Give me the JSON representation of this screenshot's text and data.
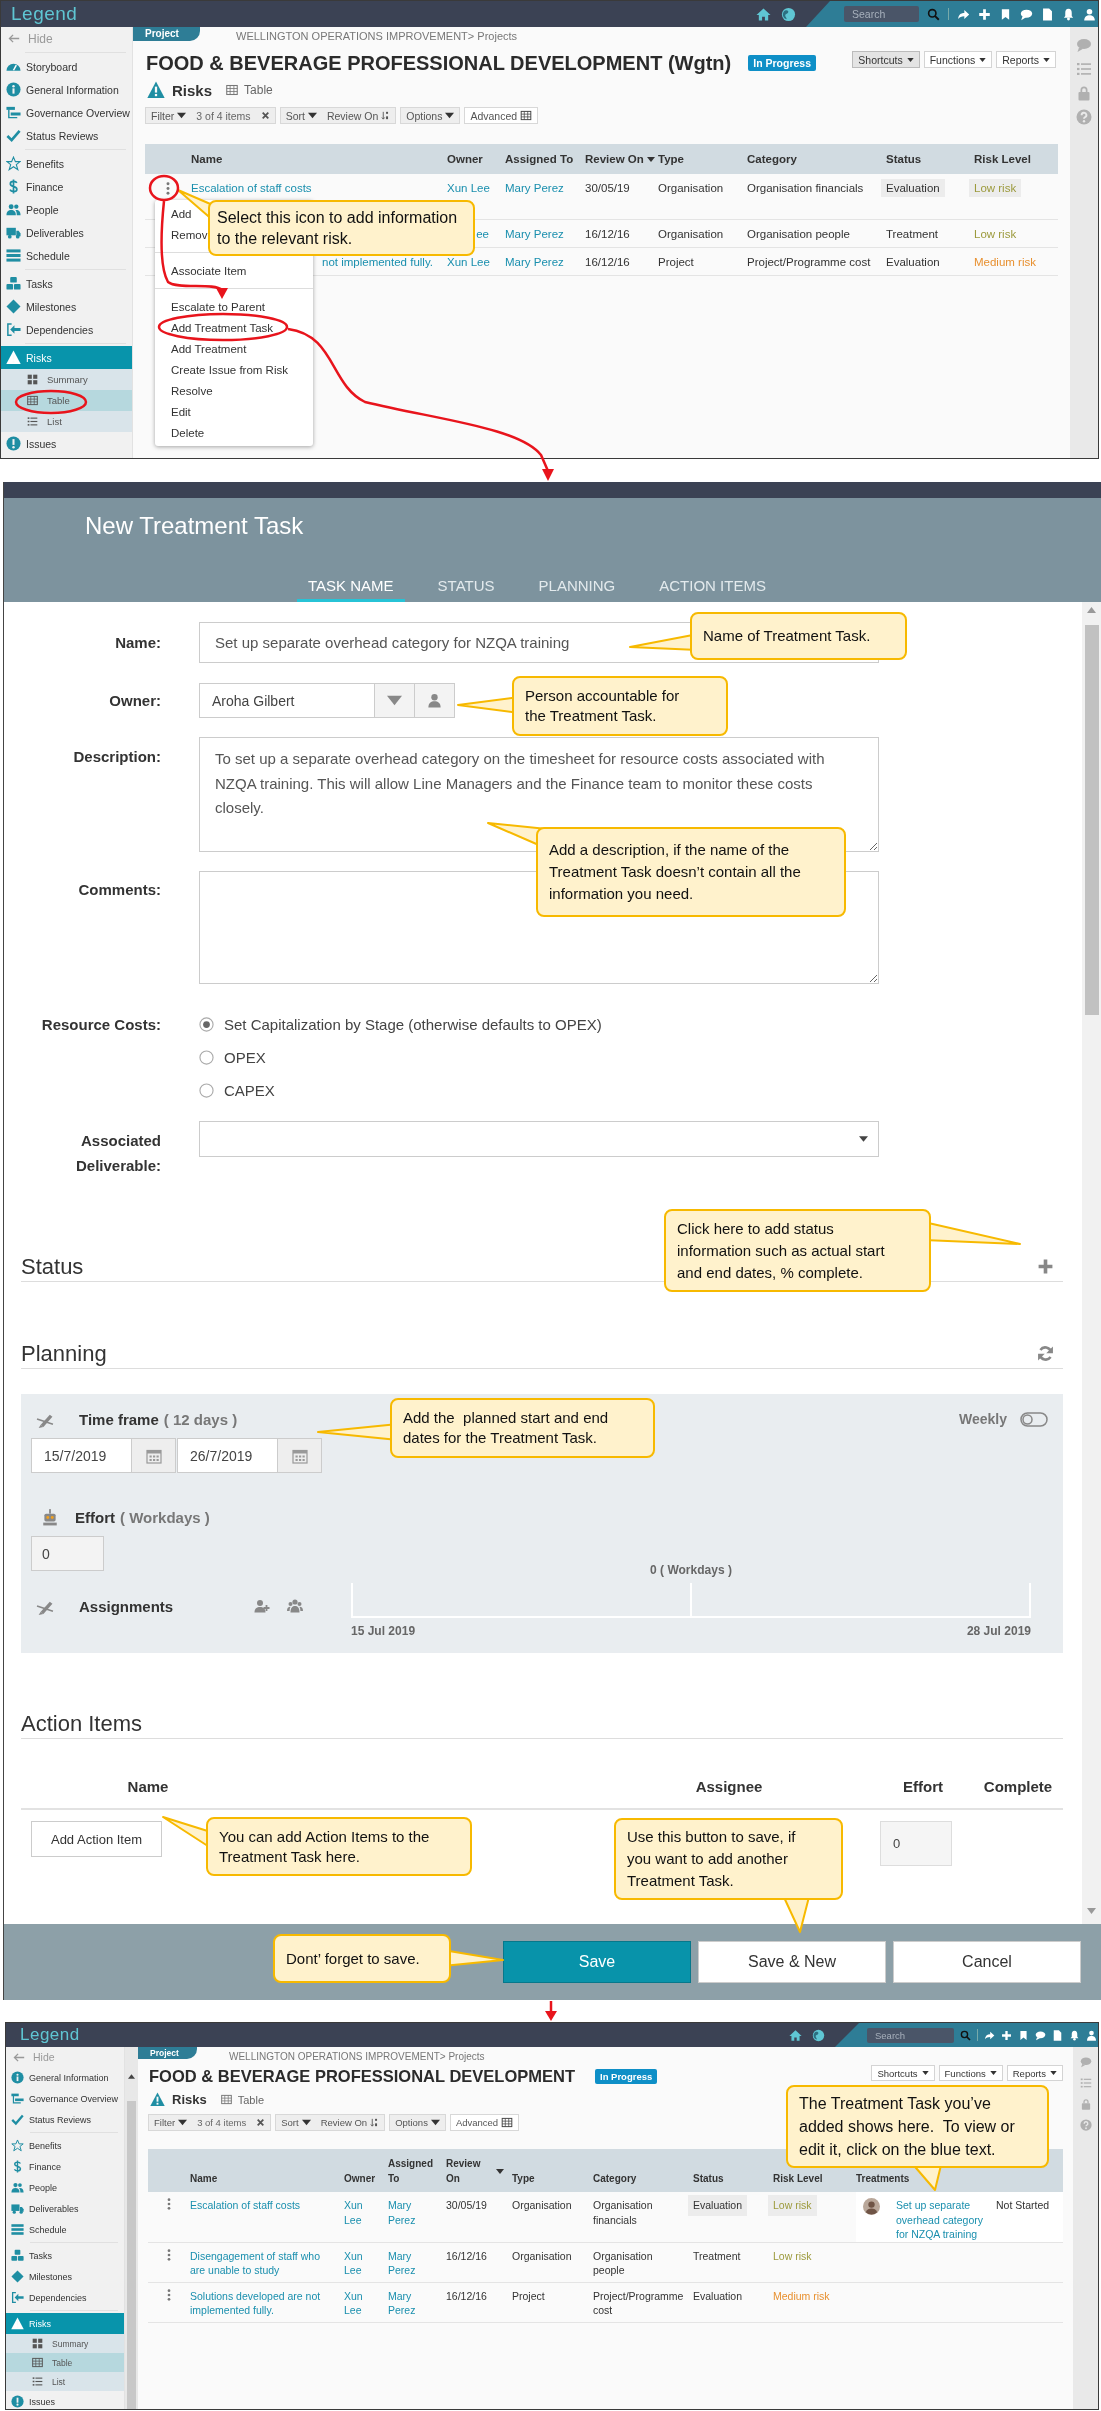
{
  "risks_table_before": {
    "top_bar": {
      "logo": "Legend",
      "search": {
        "placeholder": "Search"
      }
    },
    "sidebar": {
      "hide": "Hide",
      "groups": [
        [
          {
            "label": "Storyboard",
            "selected": false
          },
          {
            "label": "General Information",
            "selected": false
          },
          {
            "label": "Governance Overview",
            "selected": false
          },
          {
            "label": "Status Reviews",
            "selected": false
          }
        ],
        [
          {
            "label": "Benefits",
            "selected": false
          },
          {
            "label": "Finance",
            "selected": false
          },
          {
            "label": "People",
            "selected": false
          },
          {
            "label": "Deliverables",
            "selected": false
          },
          {
            "label": "Schedule",
            "selected": false
          }
        ],
        [
          {
            "label": "Tasks",
            "selected": false
          },
          {
            "label": "Milestones",
            "selected": false
          },
          {
            "label": "Dependencies",
            "selected": false
          }
        ],
        [
          {
            "label": "Risks",
            "selected": true,
            "children": [
              {
                "label": "Summary",
                "selected": false
              },
              {
                "label": "Table",
                "selected": true
              },
              {
                "label": "List",
                "selected": false
              }
            ]
          },
          {
            "label": "Issues",
            "selected": false
          }
        ]
      ]
    },
    "project_tag": "Project",
    "breadcrumb": "WELLINGTON OPERATIONS IMPROVEMENT> Projects",
    "title": "FOOD & BEVERAGE PROFESSIONAL DEVELOPMENT (Wgtn)",
    "status_badge": "In Progress",
    "header_buttons": [
      {
        "label": "Shortcuts",
        "selected": true
      },
      {
        "label": "Functions",
        "selected": false
      },
      {
        "label": "Reports",
        "selected": false
      }
    ],
    "section_title": "Risks",
    "view_label": "Table",
    "toolbar": {
      "filter": "Filter",
      "filter_count": "3 of 4 items",
      "sort": "Sort",
      "sort_field": "Review On",
      "options": "Options",
      "advanced": "Advanced"
    },
    "table": {
      "columns": [
        {
          "label": "Name",
          "sorted": false
        },
        {
          "label": "Owner",
          "sorted": false
        },
        {
          "label": "Assigned To",
          "sorted": false
        },
        {
          "label": "Review On",
          "sorted": true
        },
        {
          "label": "Type",
          "sorted": false
        },
        {
          "label": "Category",
          "sorted": false
        },
        {
          "label": "Status",
          "sorted": false
        },
        {
          "label": "Risk Level",
          "sorted": false
        }
      ],
      "rows": [
        {
          "covered": false,
          "highlighted": true,
          "name": "Escalation of staff costs",
          "owner": "Xun Lee",
          "assigned_to": "Mary Perez",
          "review_on": "30/05/19",
          "type": "Organisation",
          "category": "Organisation financials",
          "status": "Evaluation",
          "risk_level": "Low risk",
          "color": "#9c9a3c"
        },
        {
          "covered": true,
          "highlighted": false,
          "owner": "ee",
          "assigned_to": "Mary Perez",
          "review_on": "16/12/16",
          "type": "Organisation",
          "category": "Organisation people",
          "status": "Treatment",
          "risk_level": "Low risk",
          "color": "#9c9a3c"
        },
        {
          "covered": true,
          "highlighted": false,
          "name": "not implemented fully.",
          "owner": "Xun Lee",
          "assigned_to": "Mary Perez",
          "review_on": "16/12/16",
          "type": "Project",
          "category": "Project/Programme cost",
          "status": "Evaluation",
          "risk_level": "Medium risk",
          "color": "#e8902f"
        }
      ]
    },
    "context_menu": {
      "groups": [
        [
          "Add",
          "Remov"
        ],
        [
          "Associate Item"
        ],
        [
          "Escalate to Parent",
          "Add Treatment Task",
          "Add Treatment",
          "Create Issue from Risk",
          "Resolve",
          "Edit",
          "Delete"
        ]
      ]
    },
    "callouts": [
      {
        "text": "Select this icon to add information to the relevant risk."
      }
    ]
  },
  "new_treatment_task_dialog": {
    "title": "New Treatment Task",
    "tabs": [
      {
        "label": "TASK NAME",
        "selected": true
      },
      {
        "label": "STATUS",
        "selected": false
      },
      {
        "label": "PLANNING",
        "selected": false
      },
      {
        "label": "ACTION ITEMS",
        "selected": false
      }
    ],
    "fields": {
      "name": {
        "label": "Name:",
        "value": "Set up separate overhead category for NZQA training"
      },
      "owner": {
        "label": "Owner:",
        "value": "Aroha Gilbert"
      },
      "description": {
        "label": "Description:",
        "value": "To set up a separate overhead category on the timesheet for resource costs associated with NZQA training. This will allow Line Managers and the Finance team to monitor these costs closely."
      },
      "comments": {
        "label": "Comments:"
      },
      "resource_costs": {
        "label": "Resource Costs:",
        "options": [
          {
            "label": "Set Capitalization by Stage (otherwise defaults to OPEX)",
            "selected": true
          },
          {
            "label": "OPEX",
            "selected": false
          },
          {
            "label": "CAPEX",
            "selected": false
          }
        ]
      },
      "associated_deliverable": {
        "label": "Associated Deliverable:"
      }
    },
    "status_section": {
      "title": "Status"
    },
    "planning_section": {
      "title": "Planning",
      "time_frame": {
        "label": "Time frame",
        "duration": "( 12 days )",
        "start_date": "15/7/2019",
        "end_date": "26/7/2019"
      },
      "weekly": {
        "label": "Weekly",
        "on": false
      },
      "effort": {
        "label": "Effort",
        "unit": "( Workdays )",
        "value": "0"
      },
      "effort_total": "0 ( Workdays )",
      "assignments": {
        "label": "Assignments"
      },
      "timeline": {
        "start": "15 Jul 2019",
        "end": "28 Jul 2019"
      }
    },
    "action_items_section": {
      "title": "Action Items",
      "columns": [
        "Name",
        "Assignee",
        "Effort",
        "Complete"
      ],
      "add_button": "Add Action Item",
      "effort_value": "0"
    },
    "footer_buttons": [
      {
        "label": "Save",
        "kind": "primary"
      },
      {
        "label": "Save & New",
        "kind": "secondary"
      },
      {
        "label": "Cancel",
        "kind": "secondary"
      }
    ],
    "callouts": [
      {
        "text": "Name of Treatment Task."
      },
      {
        "text": "Person accountable for the Treatment Task."
      },
      {
        "text": "Add a description, if the name of the Treatment Task doesn’t contain all the information you need."
      },
      {
        "text": "Click here to add status information such as actual start and end dates, % complete."
      },
      {
        "text": "Add the  planned start and end dates for the Treatment Task."
      },
      {
        "text": "You can add Action Items to the Treatment Task here."
      },
      {
        "text": "Use this button to save, if you want to add another Treatment Task."
      },
      {
        "text": "Dont’ forget to save."
      }
    ]
  },
  "risks_table_after": {
    "top_bar": {
      "logo": "Legend",
      "search": {
        "placeholder": "Search"
      }
    },
    "sidebar": {
      "hide": "Hide",
      "groups": [
        [
          {
            "label": "General Information",
            "selected": false
          },
          {
            "label": "Governance Overview",
            "selected": false
          },
          {
            "label": "Status Reviews",
            "selected": false
          }
        ],
        [
          {
            "label": "Benefits",
            "selected": false
          },
          {
            "label": "Finance",
            "selected": false
          },
          {
            "label": "People",
            "selected": false
          },
          {
            "label": "Deliverables",
            "selected": false
          },
          {
            "label": "Schedule",
            "selected": false
          }
        ],
        [
          {
            "label": "Tasks",
            "selected": false
          },
          {
            "label": "Milestones",
            "selected": false
          },
          {
            "label": "Dependencies",
            "selected": false
          }
        ],
        [
          {
            "label": "Risks",
            "selected": true,
            "children": [
              {
                "label": "Summary",
                "selected": false
              },
              {
                "label": "Table",
                "selected": true
              },
              {
                "label": "List",
                "selected": false
              }
            ]
          },
          {
            "label": "Issues",
            "selected": false
          }
        ]
      ]
    },
    "project_tag": "Project",
    "breadcrumb": "WELLINGTON OPERATIONS IMPROVEMENT> Projects",
    "title": "FOOD & BEVERAGE PROFESSIONAL DEVELOPMENT",
    "status_badge": "In Progress",
    "header_buttons": [
      {
        "label": "Shortcuts",
        "selected": false
      },
      {
        "label": "Functions",
        "selected": false
      },
      {
        "label": "Reports",
        "selected": false
      }
    ],
    "section_title": "Risks",
    "view_label": "Table",
    "toolbar": {
      "filter": "Filter",
      "filter_count": "3 of 4 items",
      "sort": "Sort",
      "sort_field": "Review On",
      "options": "Options",
      "advanced": "Advanced"
    },
    "table": {
      "columns": [
        {
          "label": "Name",
          "sorted": false
        },
        {
          "label": "Owner",
          "sorted": false
        },
        {
          "label": "Assigned To",
          "sorted": false
        },
        {
          "label": "Review On",
          "sorted": true
        },
        {
          "label": "Type",
          "sorted": false
        },
        {
          "label": "Category",
          "sorted": false
        },
        {
          "label": "Status",
          "sorted": false
        },
        {
          "label": "Risk Level",
          "sorted": false
        },
        {
          "label": "Treatments",
          "sorted": false
        }
      ],
      "rows": [
        {
          "covered": false,
          "highlighted": true,
          "name": "Escalation of staff costs",
          "owner": "Xun Lee",
          "assigned_to": "Mary Perez",
          "review_on": "30/05/19",
          "type": "Organisation",
          "category": "Organisation financials",
          "status": "Evaluation",
          "risk_level": "Low risk",
          "color": "#9c9a3c",
          "treatment": {
            "link": "Set up separate overhead category for NZQA training",
            "status": "Not Started"
          }
        },
        {
          "covered": false,
          "highlighted": false,
          "name": "Disengagement of staff who are unable to study",
          "owner": "Xun Lee",
          "assigned_to": "Mary Perez",
          "review_on": "16/12/16",
          "type": "Organisation",
          "category": "Organisation people",
          "status": "Treatment",
          "risk_level": "Low risk",
          "color": "#9c9a3c"
        },
        {
          "covered": false,
          "highlighted": false,
          "name": "Solutions developed are not implemented fully.",
          "owner": "Xun Lee",
          "assigned_to": "Mary Perez",
          "review_on": "16/12/16",
          "type": "Project",
          "category": "Project/Programme cost",
          "status": "Evaluation",
          "risk_level": "Medium risk",
          "color": "#e8902f"
        }
      ]
    },
    "callouts": [
      {
        "text": "The Treatment Task you’ve added shows here.  To view or edit it, click on the blue text."
      }
    ]
  }
}
